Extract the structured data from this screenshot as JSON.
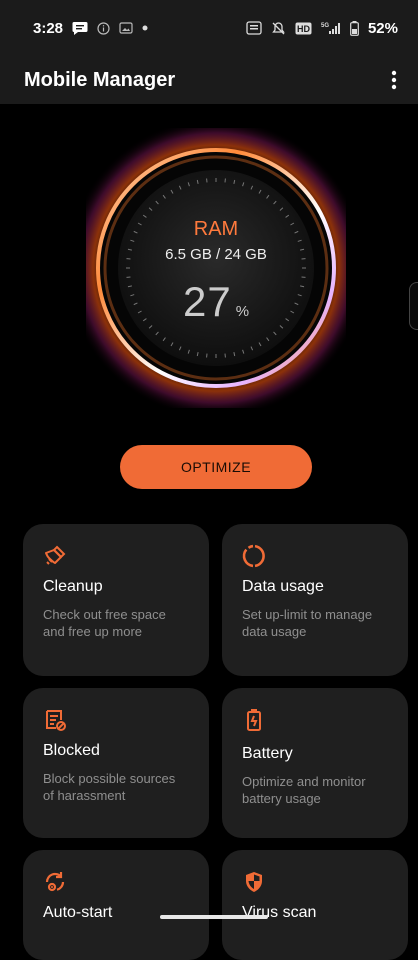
{
  "status_bar": {
    "time": "3:28",
    "battery": "52%",
    "network": "5G"
  },
  "app": {
    "title": "Mobile Manager"
  },
  "ram": {
    "label": "RAM",
    "usage": "6.5 GB / 24 GB",
    "percent": "27",
    "unit": "%"
  },
  "optimize_label": "OPTIMIZE",
  "cards": [
    {
      "icon": "broom-icon",
      "title": "Cleanup",
      "desc": "Check out free space and free up more"
    },
    {
      "icon": "data-usage-icon",
      "title": "Data usage",
      "desc": "Set up-limit to manage data usage"
    },
    {
      "icon": "blocked-icon",
      "title": "Blocked",
      "desc": "Block possible sources of harassment"
    },
    {
      "icon": "battery-icon",
      "title": "Battery",
      "desc": "Optimize and monitor battery usage"
    },
    {
      "icon": "auto-start-icon",
      "title": "Auto-start",
      "desc": ""
    },
    {
      "icon": "shield-icon",
      "title": "Virus scan",
      "desc": ""
    }
  ],
  "colors": {
    "accent": "#f06b36",
    "card_bg": "#1f1f1f",
    "bar_bg": "#1b1b1b"
  }
}
